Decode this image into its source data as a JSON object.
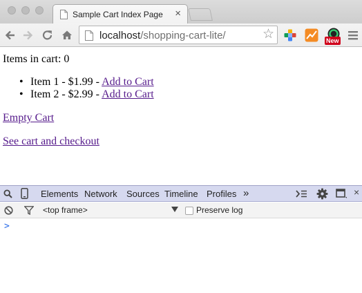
{
  "browser": {
    "tab_title": "Sample Cart Index Page",
    "url_host": "localhost",
    "url_path": "/shopping-cart-lite/",
    "extension_badge": "New",
    "colors": {
      "tab_strip": "#d4d4d4",
      "devtools_bar": "#d6d9ef",
      "link_visited": "#551a8b",
      "badge": "#d0021b"
    }
  },
  "page": {
    "cart_count_text": "Items in cart: 0",
    "items": [
      {
        "text": "Item 1 - $1.99 - ",
        "link": "Add to Cart"
      },
      {
        "text": "Item 2 - $2.99 - ",
        "link": "Add to Cart"
      }
    ],
    "empty_cart_link": "Empty Cart",
    "checkout_link": "See cart and checkout"
  },
  "devtools": {
    "tabs": [
      "Elements",
      "Network",
      "Sources",
      "Timeline",
      "Profiles"
    ],
    "more_tabs": "»",
    "frame_select_value": "<top frame>",
    "preserve_log_label": "Preserve log",
    "preserve_log_checked": false,
    "console_prompt": ">",
    "icons": [
      "search-icon",
      "device-mode-icon",
      "console-drawer-icon",
      "settings-gear-icon",
      "dock-side-icon",
      "close-icon",
      "clear-console-icon",
      "filter-icon"
    ]
  }
}
